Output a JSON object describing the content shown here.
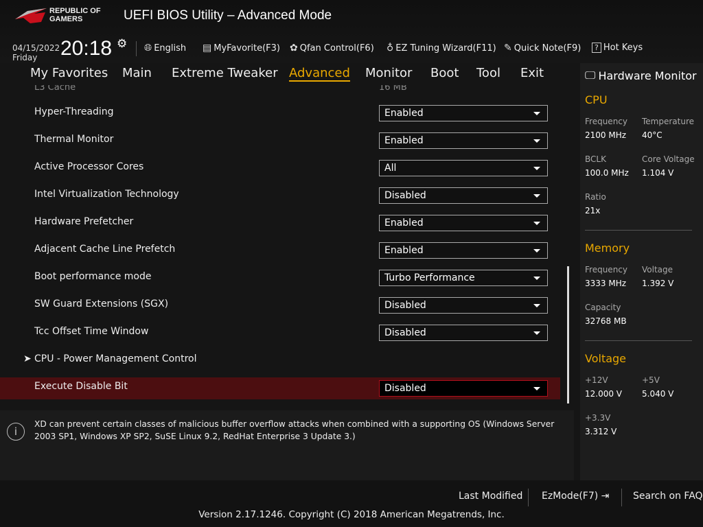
{
  "header": {
    "brand_line1": "REPUBLIC OF",
    "brand_line2": "GAMERS",
    "title": "UEFI BIOS Utility – Advanced Mode",
    "date": "04/15/2022",
    "day": "Friday",
    "time": "20:18",
    "tools": [
      {
        "icon": "globe-icon",
        "label": "English"
      },
      {
        "icon": "favorite-icon",
        "label": "MyFavorite(F3)"
      },
      {
        "icon": "fan-icon",
        "label": "Qfan Control(F6)"
      },
      {
        "icon": "bulb-icon",
        "label": "EZ Tuning Wizard(F11)"
      },
      {
        "icon": "note-icon",
        "label": "Quick Note(F9)"
      },
      {
        "icon": "help-icon",
        "label": "Hot Keys"
      }
    ]
  },
  "tabs": [
    "My Favorites",
    "Main",
    "Extreme Tweaker",
    "Advanced",
    "Monitor",
    "Boot",
    "Tool",
    "Exit"
  ],
  "active_tab": "Advanced",
  "partial_row": {
    "label": "L3 Cache",
    "value": "16 MB"
  },
  "settings": [
    {
      "label": "Hyper-Threading",
      "value": "Enabled"
    },
    {
      "label": "Thermal Monitor",
      "value": "Enabled"
    },
    {
      "label": "Active Processor Cores",
      "value": "All"
    },
    {
      "label": "Intel Virtualization Technology",
      "value": "Disabled"
    },
    {
      "label": "Hardware Prefetcher",
      "value": "Enabled"
    },
    {
      "label": "Adjacent Cache Line Prefetch",
      "value": "Enabled"
    },
    {
      "label": "Boot performance mode",
      "value": "Turbo Performance"
    },
    {
      "label": "SW Guard Extensions (SGX)",
      "value": "Disabled"
    },
    {
      "label": "Tcc Offset Time Window",
      "value": "Disabled"
    }
  ],
  "submenu": "CPU - Power Management Control",
  "selected": {
    "label": "Execute Disable Bit",
    "value": "Disabled"
  },
  "help": "XD can prevent certain classes of malicious buffer overflow attacks when combined with a supporting OS (Windows Server 2003 SP1, Windows XP SP2, SuSE Linux 9.2, RedHat Enterprise 3 Update 3.)",
  "hw": {
    "title": "Hardware Monitor",
    "cpu": {
      "title": "CPU",
      "freq_k": "Frequency",
      "freq": "2100 MHz",
      "temp_k": "Temperature",
      "temp": "40°C",
      "bclk_k": "BCLK",
      "bclk": "100.0 MHz",
      "cv_k": "Core Voltage",
      "cv": "1.104 V",
      "ratio_k": "Ratio",
      "ratio": "21x"
    },
    "mem": {
      "title": "Memory",
      "freq_k": "Frequency",
      "freq": "3333 MHz",
      "volt_k": "Voltage",
      "volt": "1.392 V",
      "cap_k": "Capacity",
      "cap": "32768 MB"
    },
    "volt": {
      "title": "Voltage",
      "v12_k": "+12V",
      "v12": "12.000 V",
      "v5_k": "+5V",
      "v5": "5.040 V",
      "v33_k": "+3.3V",
      "v33": "3.312 V"
    }
  },
  "footer": {
    "last_modified": "Last Modified",
    "ezmode": "EzMode(F7)",
    "faq": "Search on FAQ",
    "version": "Version 2.17.1246. Copyright (C) 2018 American Megatrends, Inc."
  },
  "colors": {
    "accent": "#e9a800",
    "selected_row": "#4c0e10"
  }
}
